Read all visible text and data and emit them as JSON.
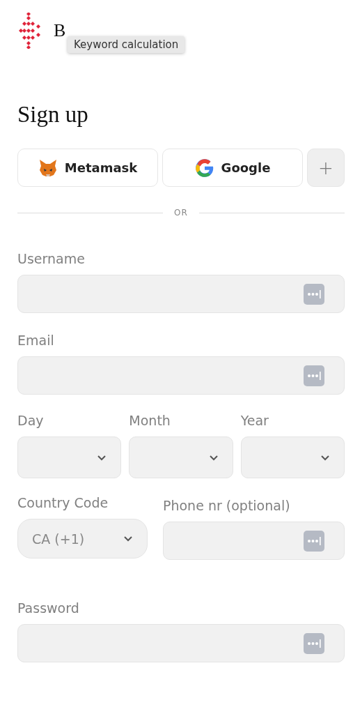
{
  "header": {
    "logo_text": "B",
    "tooltip": "Keyword calculation"
  },
  "title": "Sign up",
  "social_buttons": [
    {
      "kind": "metamask",
      "label": "Metamask"
    },
    {
      "kind": "google",
      "label": "Google"
    },
    {
      "kind": "more",
      "label": "+"
    }
  ],
  "divider": "OR",
  "fields": [
    {
      "label": "Username"
    },
    {
      "label": "Email"
    }
  ],
  "date_fields": [
    {
      "label": "Day"
    },
    {
      "label": "Month"
    },
    {
      "label": "Year"
    }
  ],
  "country_code": {
    "label": "Country Code",
    "value": "CA (+1)"
  },
  "phone": {
    "label": "Phone nr (optional)"
  },
  "password": {
    "label": "Password"
  }
}
